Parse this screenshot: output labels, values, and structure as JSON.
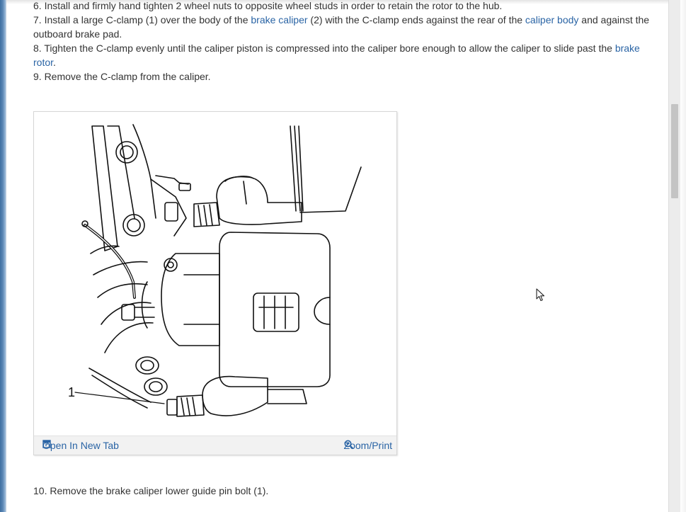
{
  "steps": {
    "step6": "6. Install and firmly hand tighten 2 wheel nuts to opposite wheel studs in order to retain the rotor to the hub.",
    "step7": {
      "num": "7.",
      "t1": " Install a large C-clamp (1) over the body of the ",
      "link1": "brake caliper",
      "t2": " (2) with the C-clamp ends against the rear of the ",
      "link2": "caliper body",
      "t3": " and against the outboard brake pad."
    },
    "step8": {
      "num": "8.",
      "t1": " Tighten the C-clamp evenly until the caliper piston is compressed into the caliper bore enough to allow the caliper to slide past the ",
      "link1": "brake rotor",
      "t2": "."
    },
    "step9": "9. Remove the C-clamp from the caliper.",
    "step10": "10. Remove the brake caliper lower guide pin bolt (1)."
  },
  "figure": {
    "callout": "1",
    "open_new_tab": "Open In New Tab",
    "zoom_print": "Zoom/Print"
  },
  "colors": {
    "link": "#2a64a5",
    "text": "#333333",
    "footer_bg": "#f2f2f2"
  },
  "icons": {
    "open_new_tab": "new-tab-icon",
    "zoom_print": "magnifier-icon",
    "cursor": "mouse-pointer-icon"
  }
}
